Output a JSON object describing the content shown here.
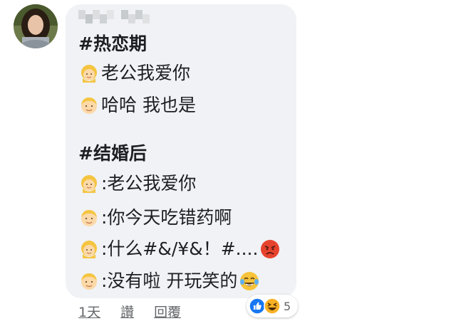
{
  "comment": {
    "author_name": "",
    "lines": {
      "h1": "#热恋期",
      "l1": "老公我爱你",
      "l2": "哈哈 我也是",
      "h2": "#结婚后",
      "l3": ":老公我爱你",
      "l4": ":你今天吃错药啊",
      "l5": ":什么#&/¥&！#....",
      "l6": ":没有啦 开玩笑的"
    },
    "emoji": {
      "female": "woman-emoji",
      "male": "man-emoji",
      "angry": "angry-face-emoji",
      "laugh": "laughing-tears-emoji"
    }
  },
  "actions": {
    "time": "1天",
    "like": "讚",
    "reply": "回覆"
  },
  "reactions": {
    "icons": [
      "like-reaction-icon",
      "haha-reaction-icon"
    ],
    "count": "5",
    "colors": {
      "like": "#1877f2",
      "haha": "#f7b125"
    }
  },
  "colors": {
    "bubble": "#f0f2f5",
    "text": "#1c1e21",
    "meta": "#65676b"
  }
}
